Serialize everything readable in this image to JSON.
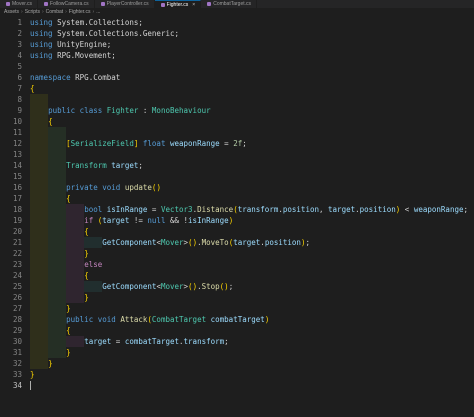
{
  "tabs": [
    {
      "label": "Mover.cs",
      "active": false
    },
    {
      "label": "FollowCamera.cs",
      "active": false
    },
    {
      "label": "PlayerController.cs",
      "active": false
    },
    {
      "label": "Fighter.cs",
      "active": true
    },
    {
      "label": "CombatTarget.cs",
      "active": false
    }
  ],
  "breadcrumb": [
    "Assets",
    "Scripts",
    "Combat",
    "Fighter.cs",
    "..."
  ],
  "line_numbers": [
    "1",
    "2",
    "3",
    "4",
    "5",
    "6",
    "7",
    "8",
    "9",
    "10",
    "11",
    "12",
    "13",
    "14",
    "15",
    "16",
    "17",
    "18",
    "19",
    "20",
    "21",
    "22",
    "23",
    "24",
    "25",
    "26",
    "27",
    "28",
    "29",
    "30",
    "31",
    "32",
    "33",
    "34"
  ],
  "current_line": "34",
  "code_lines": [
    "using System.Collections;",
    "using System.Collections.Generic;",
    "using UnityEngine;",
    "using RPG.Movement;",
    "",
    "namespace RPG.Combat",
    "{",
    "",
    "    public class Fighter : MonoBehaviour",
    "    {",
    "",
    "        [SerializeField] float weaponRange = 2f;",
    "",
    "        Transform target;",
    "",
    "        private void update()",
    "        {",
    "            bool isInRange = Vector3.Distance(transform.position, target.position) < weaponRange;",
    "            if (target != null && !isInRange)",
    "            {",
    "                GetComponent<Mover>().MoveTo(target.position);",
    "            }",
    "            else",
    "            {",
    "                GetComponent<Mover>().Stop();",
    "            }",
    "        }",
    "        public void Attack(CombatTarget combatTarget)",
    "        {",
    "            target = combatTarget.transform;",
    "        }",
    "    }",
    "}",
    ""
  ],
  "icons": {
    "tab_file_icon": "csharp-file-icon",
    "tab_close": "close-icon",
    "breadcrumb_separator": "chevron-right-icon"
  }
}
